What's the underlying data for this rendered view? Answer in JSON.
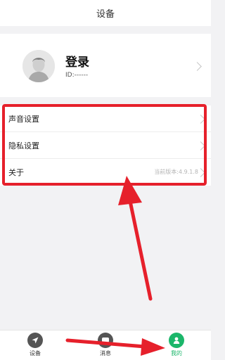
{
  "header": {
    "title": "设备"
  },
  "profile": {
    "name": "登录",
    "id_text": "ID:------"
  },
  "settings": [
    {
      "label": "声音设置",
      "value": ""
    },
    {
      "label": "隐私设置",
      "value": ""
    },
    {
      "label": "关于",
      "value": "当前版本:4.9.1.8"
    }
  ],
  "tabs": [
    {
      "label": "设备",
      "icon": "navigation-icon",
      "active": false
    },
    {
      "label": "消息",
      "icon": "message-icon",
      "active": false
    },
    {
      "label": "我的",
      "icon": "user-icon",
      "active": true
    }
  ],
  "colors": {
    "accent": "#1bb66a",
    "annotation": "#e6202b",
    "inactive_icon": "#555555"
  }
}
